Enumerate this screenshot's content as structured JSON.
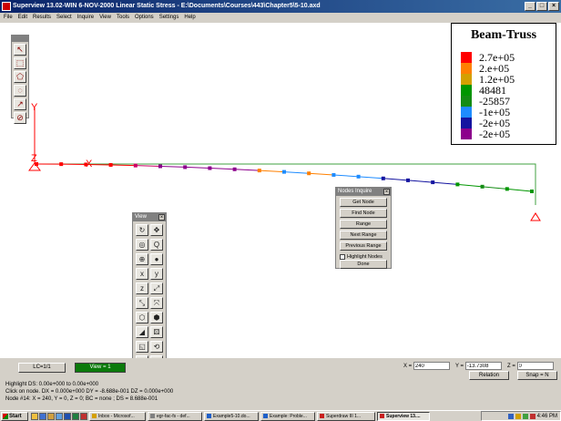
{
  "window": {
    "title": "Superview 13.02-WIN 6-NOV-2000 Linear Static Stress - E:\\Documents\\Courses\\443\\Chapter5\\5-10.axd",
    "buttons": [
      "_",
      "□",
      "×"
    ]
  },
  "menu": [
    "File",
    "Edit",
    "Results",
    "Select",
    "Inquire",
    "View",
    "Tools",
    "Options",
    "Settings",
    "Help"
  ],
  "palette_icons": [
    "select-arrow-icon",
    "select-box-icon",
    "select-polygon-icon",
    "select-circle-icon",
    "select-element-icon",
    "unselect-icon"
  ],
  "legend": {
    "title": "Beam-Truss",
    "entries": [
      {
        "color": "#ff0000",
        "label": "2.7e+05"
      },
      {
        "color": "#ff8000",
        "label": "2.e+05"
      },
      {
        "color": "#d4a000",
        "label": "1.2e+05"
      },
      {
        "color": "#009600",
        "label": "48481"
      },
      {
        "color": "#148c14",
        "label": "-25857"
      },
      {
        "color": "#1e8cff",
        "label": "-1e+05"
      },
      {
        "color": "#1414a0",
        "label": "-2e+05"
      },
      {
        "color": "#8c008c",
        "label": "-2e+05"
      }
    ]
  },
  "model": {
    "axis_labels": {
      "y": "Y",
      "z": "Z",
      "x": "X"
    },
    "node_colors": [
      "#ff0000",
      "#ff0000",
      "#ff0000",
      "#ff0000",
      "#cc0066",
      "#8c008c",
      "#8c008c",
      "#8c008c",
      "#8c008c",
      "#ff8000",
      "#1e8cff",
      "#ff8000",
      "#1e8cff",
      "#1e8cff",
      "#1414a0",
      "#1414a0",
      "#1414a0",
      "#009600",
      "#148c14",
      "#009600",
      "#009600"
    ]
  },
  "nodes_panel": {
    "title": "Nodes Inquire",
    "buttons": [
      "Get Node",
      "Find Node",
      "Range",
      "Next Range",
      "Previous Range"
    ],
    "checkbox_label": "Highlight Nodes",
    "done": "Done"
  },
  "view_panel": {
    "title": "View",
    "icons": [
      {
        "name": "rotate-icon",
        "glyph": "↻"
      },
      {
        "name": "pan-icon",
        "glyph": "✥"
      },
      {
        "name": "orbit-icon",
        "glyph": "◎"
      },
      {
        "name": "zoom-window-icon",
        "glyph": "Q"
      },
      {
        "name": "fit-icon",
        "glyph": "⊕"
      },
      {
        "name": "shade-icon",
        "glyph": "●"
      },
      {
        "name": "view-x-icon",
        "glyph": "x"
      },
      {
        "name": "view-y-icon",
        "glyph": "y"
      },
      {
        "name": "view-z-icon",
        "glyph": "z"
      },
      {
        "name": "view-xz-icon",
        "glyph": "⤢"
      },
      {
        "name": "view-yz-icon",
        "glyph": "⤡"
      },
      {
        "name": "view-xy-icon",
        "glyph": "⤧"
      },
      {
        "name": "iso-view-icon",
        "glyph": "⬡"
      },
      {
        "name": "persp-view-icon",
        "glyph": "⬢"
      },
      {
        "name": "perspective-icon",
        "glyph": "◢"
      },
      {
        "name": "dice-icon",
        "glyph": "⚄"
      },
      {
        "name": "hidden-line-icon",
        "glyph": "◱"
      },
      {
        "name": "recent-view-icon",
        "glyph": "⟲"
      },
      {
        "name": "pencil-icon",
        "glyph": "✎"
      },
      {
        "name": "magnify-icon",
        "glyph": "⊙"
      },
      {
        "name": "zoom-in-icon",
        "glyph": "+"
      },
      {
        "name": "zoom-out-icon",
        "glyph": "−"
      }
    ]
  },
  "status": {
    "lc": "LC=1/1",
    "view": "View = 1",
    "x_label": "X =",
    "x_value": "240",
    "y_label": "Y =",
    "y_value": "-13.7308",
    "z_label": "Z =",
    "z_value": "0",
    "relation": "Relation",
    "snap": "Snap = N",
    "line1": "Highlight DS: 0.00e+000 to 0.00e+000",
    "line2": "Click on node.          DX = 0.000e+000 DY = -8.688e-001 DZ = 0.000e+000",
    "line3": "Node #14: X = 240, Y = 0, Z = 0; BC = none  ; DS = 8.688e-001"
  },
  "taskbar": {
    "start": "Start",
    "tasks": [
      {
        "label": "Inbox - Microsof...",
        "color": "#d4a000"
      },
      {
        "label": "egr-fac-fs - def...",
        "color": "#808080"
      },
      {
        "label": "Example5-10.do...",
        "color": "#1e5fc8"
      },
      {
        "label": "Example: Proble...",
        "color": "#1e5fc8"
      },
      {
        "label": "Superdraw III 1...",
        "color": "#c81e1e"
      },
      {
        "label": "Superview 13....",
        "color": "#c81e1e",
        "active": true
      }
    ],
    "clock": "4:46 PM"
  }
}
